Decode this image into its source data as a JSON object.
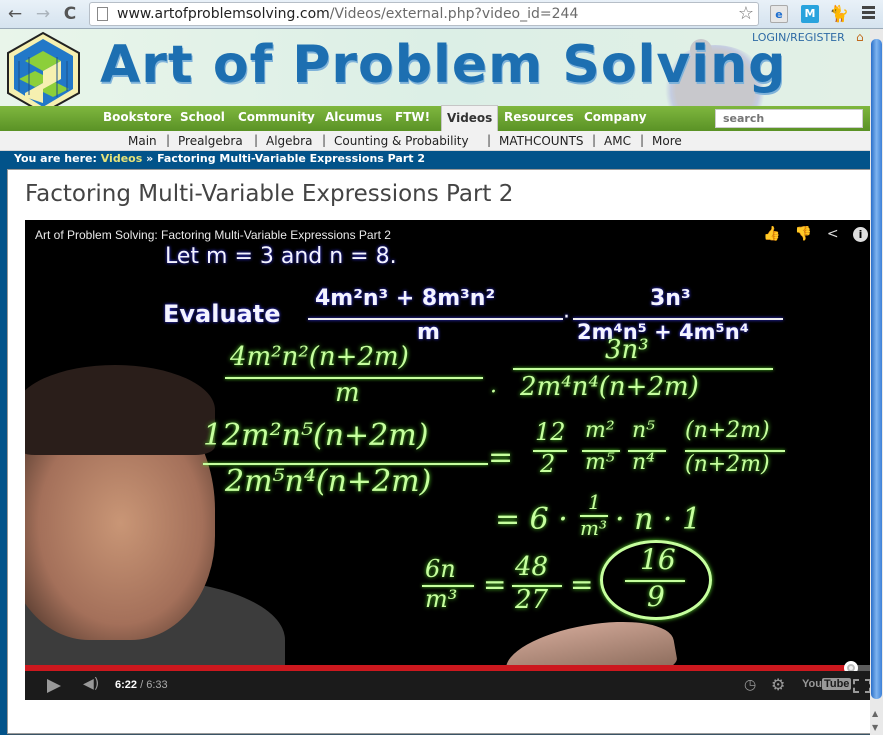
{
  "browser": {
    "url_host": "www.artofproblemsolving.com",
    "url_path": "/Videos/external.php?video_id=244",
    "back_icon": "back-arrow-icon",
    "forward_icon": "forward-arrow-icon",
    "reload_icon": "reload-icon",
    "bookmark_icon": "star-icon",
    "extensions": [
      "ie-tab-icon",
      "m-extension-icon",
      "cat-extension-icon"
    ],
    "menu_icon": "hamburger-menu-icon"
  },
  "site": {
    "brand": "Art of Problem Solving",
    "login_label": "LOGIN/REGISTER",
    "nav": [
      {
        "label": "Bookstore",
        "active": false
      },
      {
        "label": "School",
        "active": false
      },
      {
        "label": "Community",
        "active": false
      },
      {
        "label": "Alcumus",
        "active": false
      },
      {
        "label": "FTW!",
        "active": false
      },
      {
        "label": "Videos",
        "active": true
      },
      {
        "label": "Resources",
        "active": false
      },
      {
        "label": "Company",
        "active": false
      }
    ],
    "search_placeholder": "search",
    "subnav": [
      "Main",
      "Prealgebra",
      "Algebra",
      "Counting & Probability",
      "MATHCOUNTS",
      "AMC",
      "More"
    ],
    "breadcrumb": {
      "prefix": "You are here:",
      "link": "Videos",
      "separator": "»",
      "current": "Factoring Multi-Variable Expressions Part 2"
    },
    "colors": {
      "nav_green": "#6aa232",
      "breadcrumb_blue": "#02538a",
      "breadcrumb_link": "#e6e37a",
      "brand_blue": "#1d6fb1"
    }
  },
  "page": {
    "title": "Factoring Multi-Variable Expressions Part 2"
  },
  "video": {
    "title": "Art of Problem Solving: Factoring Multi-Variable Expressions Part 2",
    "top_icons": [
      "thumbs-up-icon",
      "thumbs-down-icon",
      "share-icon",
      "info-icon"
    ],
    "board": {
      "given": "Let m = 3 and n = 8.",
      "evaluate_label": "Evaluate",
      "frac1_num": "4m²n³ + 8m³n²",
      "frac1_den": "m",
      "dot": "·",
      "frac2_num": "3n³",
      "frac2_den": "2m⁴n⁵ + 4m⁵n⁴",
      "step1_num_a": "4m²n²(n+2m)",
      "step1_den_a": "m",
      "step1_num_b": "3n³",
      "step1_den_b": "2m⁴n⁴(n+2m)",
      "step2_num": "12m²n⁵(n+2m)",
      "step2_den": "2m⁵n⁴(n+2m)",
      "step2_rhs": "= 12/2 · m²/m⁵ · n⁵/n⁴ · (n+2m)/(n+2m)",
      "step2_eq": "=",
      "r_12": "12",
      "r_2": "2",
      "r_m2": "m²",
      "r_m5": "m⁵",
      "r_n5": "n⁵",
      "r_n4": "n⁴",
      "r_n2m_top": "(n+2m)",
      "r_n2m_bot": "(n+2m)",
      "step3": "= 6 · 1/m³ · n · 1",
      "step3_a": "= 6 ·",
      "step3_one": "1",
      "step3_m3": "m³",
      "step3_b": "· n · 1",
      "step4_num": "6n",
      "step4_den": "m³",
      "step4_eq": "=",
      "step4_num2": "48",
      "step4_den2": "27",
      "answer_num": "16",
      "answer_den": "9"
    },
    "progress_fraction": 0.972,
    "time_current": "6:22",
    "time_total": "/ 6:33",
    "controls": [
      "play-icon",
      "volume-icon",
      "watch-later-icon",
      "settings-gear-icon",
      "youtube-logo",
      "fullscreen-icon"
    ],
    "youtube_you": "You",
    "youtube_tube": "Tube",
    "colors": {
      "progress_red": "#cc181e",
      "chalk_green": "#c6ff9e"
    }
  }
}
